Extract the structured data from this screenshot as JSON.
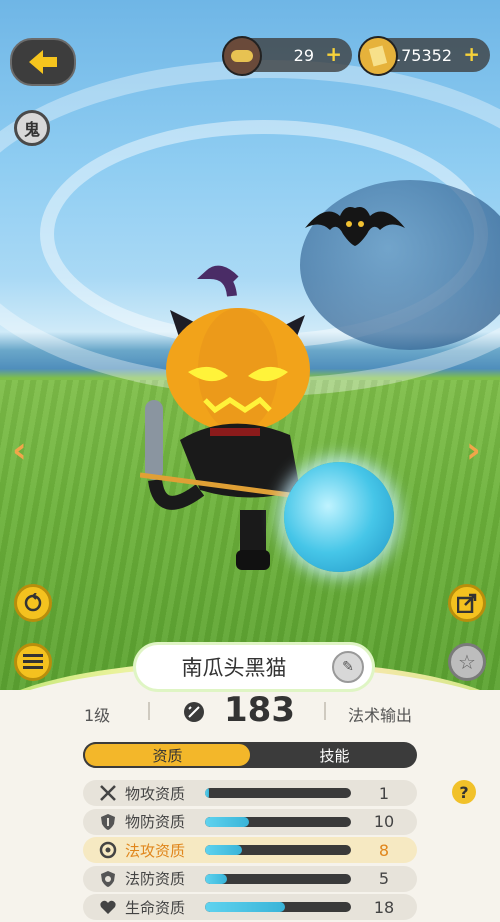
{
  "header": {
    "currency_coins": "29",
    "currency_tickets": "175352",
    "ghost_badge": "鬼"
  },
  "pet": {
    "name": "南瓜头黑猫",
    "level": "1级",
    "power": "183",
    "role": "法术输出"
  },
  "tabs": [
    {
      "label": "资质",
      "active": true
    },
    {
      "label": "技能",
      "active": false
    }
  ],
  "stats": [
    {
      "label": "物攻资质",
      "value": "1",
      "fill": 0.03,
      "icon": "crossed-swords-icon",
      "highlight": false
    },
    {
      "label": "物防资质",
      "value": "10",
      "fill": 0.3,
      "icon": "shield-icon",
      "highlight": false
    },
    {
      "label": "法攻资质",
      "value": "8",
      "fill": 0.25,
      "icon": "magic-swirl-icon",
      "highlight": true
    },
    {
      "label": "法防资质",
      "value": "5",
      "fill": 0.15,
      "icon": "magic-shield-icon",
      "highlight": false
    },
    {
      "label": "生命资质",
      "value": "18",
      "fill": 0.55,
      "icon": "heart-icon",
      "highlight": false
    }
  ],
  "colors": {
    "accent": "#f3b72a",
    "highlight_text": "#e0861c",
    "bar_fill": "#39b4d8"
  }
}
